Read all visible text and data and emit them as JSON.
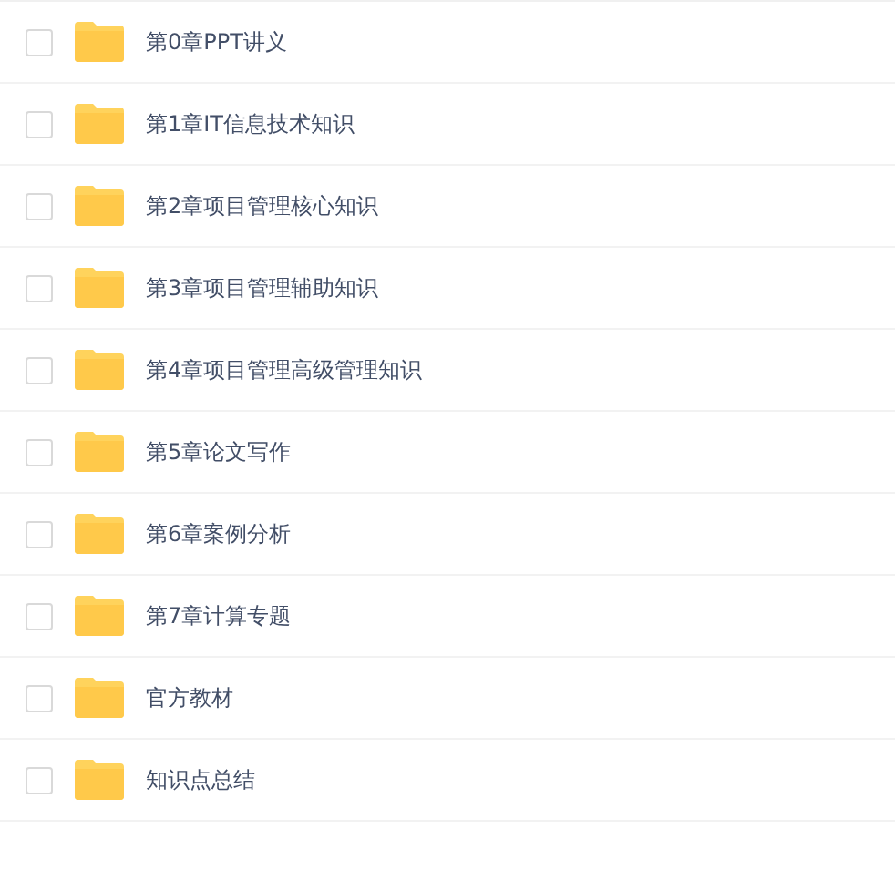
{
  "files": [
    {
      "name": "第0章PPT讲义",
      "checked": false
    },
    {
      "name": "第1章IT信息技术知识",
      "checked": false
    },
    {
      "name": "第2章项目管理核心知识",
      "checked": false
    },
    {
      "name": "第3章项目管理辅助知识",
      "checked": false
    },
    {
      "name": "第4章项目管理高级管理知识",
      "checked": false
    },
    {
      "name": "第5章论文写作",
      "checked": false
    },
    {
      "name": "第6章案例分析",
      "checked": false
    },
    {
      "name": "第7章计算专题",
      "checked": false
    },
    {
      "name": "官方教材",
      "checked": false
    },
    {
      "name": "知识点总结",
      "checked": false
    }
  ]
}
